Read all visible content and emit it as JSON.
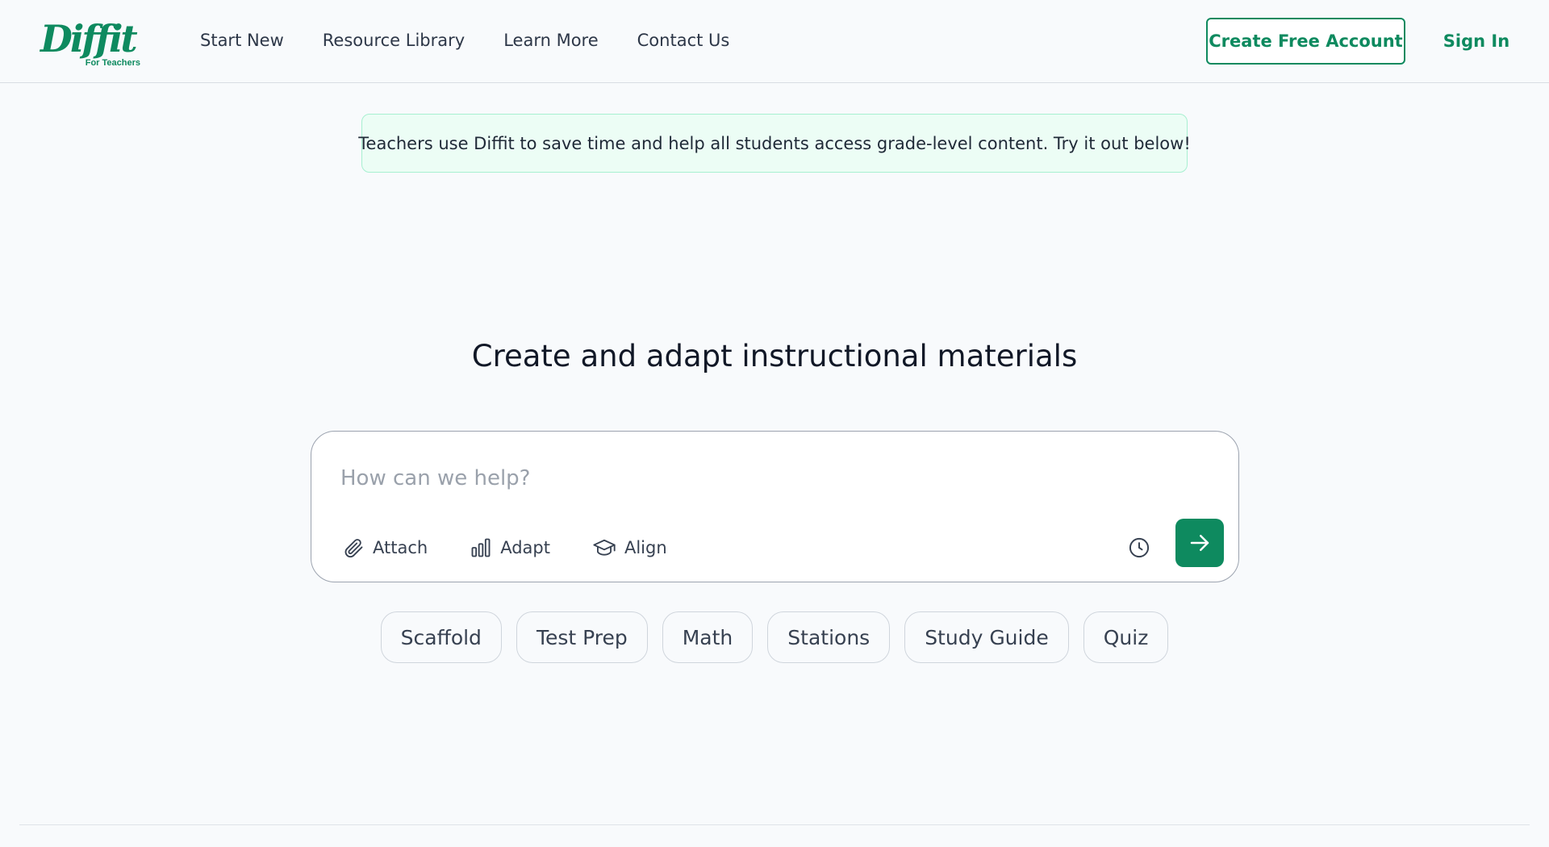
{
  "brand": {
    "name": "Diffit",
    "tagline": "For Teachers",
    "accent_color": "#0e8a5f"
  },
  "nav": {
    "items": [
      {
        "label": "Start New"
      },
      {
        "label": "Resource Library"
      },
      {
        "label": "Learn More"
      },
      {
        "label": "Contact Us"
      }
    ]
  },
  "header": {
    "create_account_label": "Create Free Account",
    "sign_in_label": "Sign In"
  },
  "banner": {
    "text": "Teachers use Diffit to save time and help all students access grade-level content. Try it out below!"
  },
  "main": {
    "headline": "Create and adapt instructional materials",
    "prompt": {
      "placeholder": "How can we help?",
      "value": ""
    },
    "tools": [
      {
        "label": "Attach",
        "icon": "paperclip-icon"
      },
      {
        "label": "Adapt",
        "icon": "bar-chart-icon"
      },
      {
        "label": "Align",
        "icon": "graduation-cap-icon"
      }
    ],
    "history_icon": "clock-icon",
    "send_icon": "arrow-right-icon"
  },
  "chips": [
    {
      "label": "Scaffold"
    },
    {
      "label": "Test Prep"
    },
    {
      "label": "Math"
    },
    {
      "label": "Stations"
    },
    {
      "label": "Study Guide"
    },
    {
      "label": "Quiz"
    }
  ]
}
